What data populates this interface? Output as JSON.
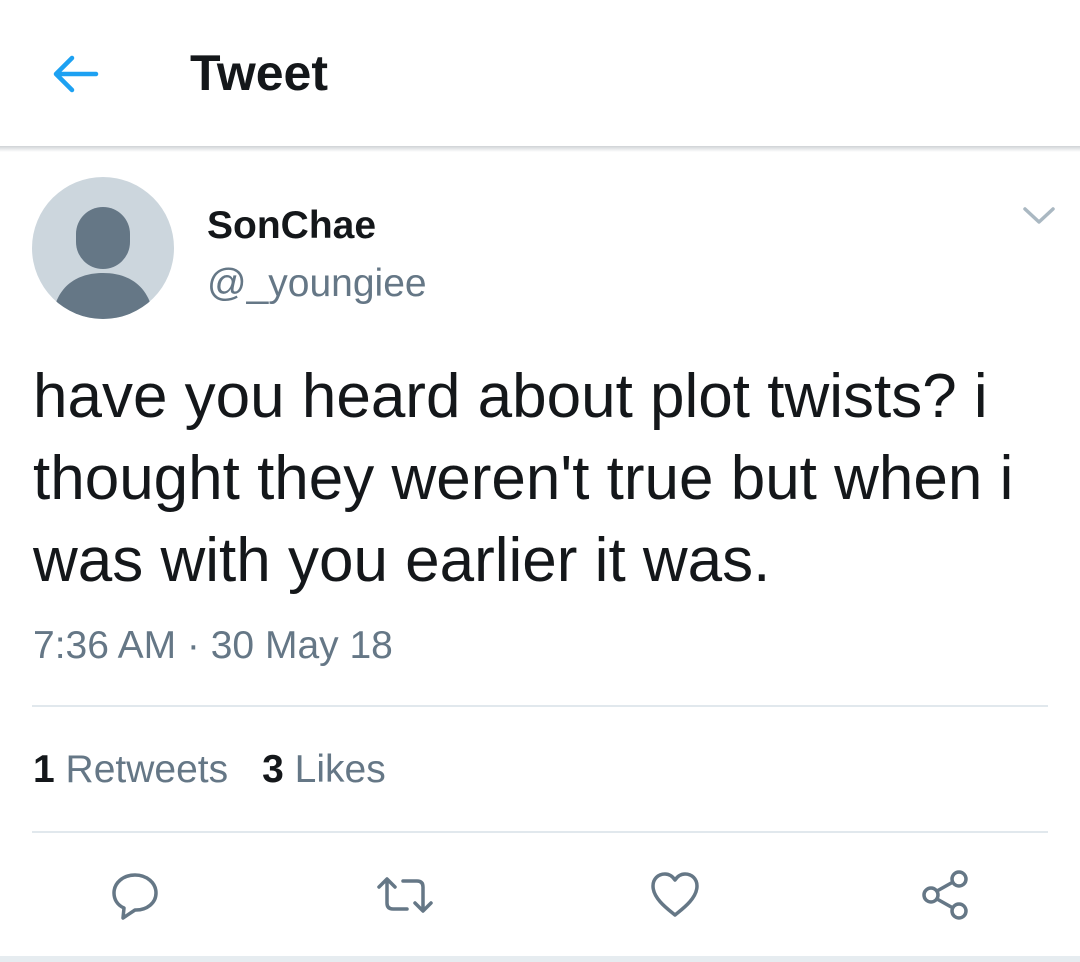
{
  "header": {
    "title": "Tweet",
    "back_icon": "arrow-left-icon",
    "accent_color": "#1da1f2"
  },
  "tweet": {
    "author": {
      "name": "SonChae",
      "handle": "@_youngiee",
      "avatar_icon": "default-avatar-icon"
    },
    "text": "have you heard about plot twists? i thought they weren't true but when i was with you earlier it was.",
    "timestamp": "7:36 AM · 30 May 18",
    "stats": {
      "retweets_count": "1",
      "retweets_label": "Retweets",
      "likes_count": "3",
      "likes_label": "Likes"
    },
    "actions": [
      "reply-icon",
      "retweet-icon",
      "like-icon",
      "share-icon"
    ]
  },
  "colors": {
    "primary_text": "#14171a",
    "secondary_text": "#657786",
    "divider": "#e1e8ed",
    "avatar_bg": "#ccd6dd",
    "avatar_fg": "#657786"
  }
}
